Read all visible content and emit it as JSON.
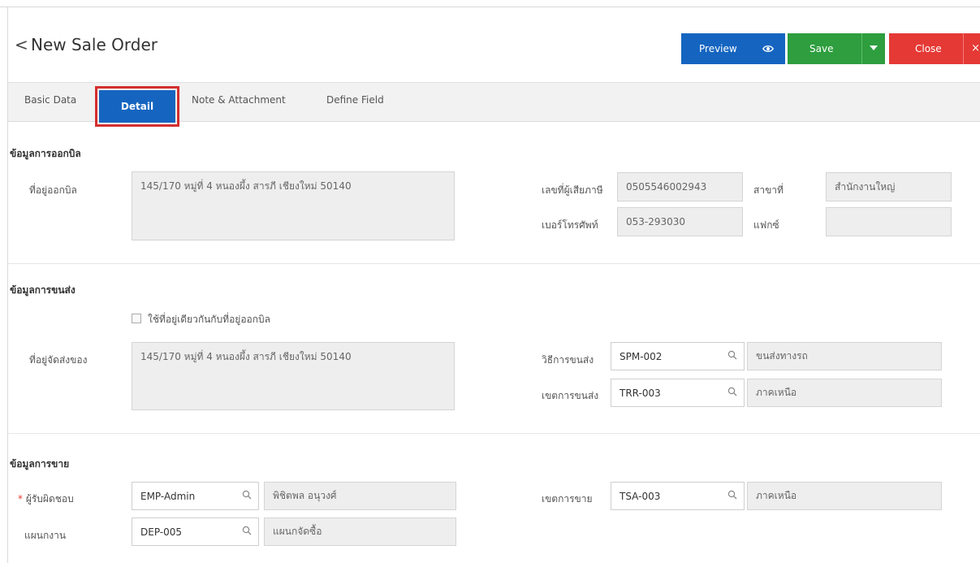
{
  "header": {
    "back_icon": "chevron-left-icon",
    "back_glyph": "<",
    "title": "New Sale Order",
    "preview_label": "Preview",
    "save_label": "Save",
    "close_label": "Close",
    "close_glyph": "×",
    "colors": {
      "preview": "#1565c0",
      "save": "#2e9e3e",
      "close": "#e53935"
    }
  },
  "tabs": [
    {
      "label": "Basic Data"
    },
    {
      "label": "Detail",
      "active": true
    },
    {
      "label": "Note & Attachment"
    },
    {
      "label": "Define Field"
    }
  ],
  "billing": {
    "title": "ข้อมูลการออกบิล",
    "address_label": "ที่อยู่ออกบิล",
    "address_value": "145/170 หมู่ที่ 4    หนองผึ้ง สารภี เชียงใหม่ 50140",
    "tax_id_label": "เลขที่ผู้เสียภาษี",
    "tax_id_value": "0505546002943",
    "branch_label": "สาขาที่",
    "branch_value": "สำนักงานใหญ่",
    "phone_label": "เบอร์โทรศัพท์",
    "phone_value": "053-293030",
    "fax_label": "แฟกซ์",
    "fax_value": ""
  },
  "shipping": {
    "title": "ข้อมูลการขนส่ง",
    "same_address_label": "ใช้ที่อยู่เดียวกันกับที่อยู่ออกบิล",
    "same_address_checked": false,
    "address_label": "ที่อยู่จัดส่งของ",
    "address_value": "145/170 หมู่ที่ 4    หนองผึ้ง สารภี เชียงใหม่ 50140",
    "method_label": "วิธีการขนส่ง",
    "method_code": "SPM-002",
    "method_name": "ขนส่งทางรถ",
    "zone_label": "เขตการขนส่ง",
    "zone_code": "TRR-003",
    "zone_name": "ภาคเหนือ"
  },
  "sales": {
    "title": "ข้อมูลการขาย",
    "required_mark": "*",
    "owner_label": "ผู้รับผิดชอบ",
    "owner_code": "EMP-Admin",
    "owner_name": "พิชิตพล อนุวงศ์",
    "dept_label": "แผนกงาน",
    "dept_code": "DEP-005",
    "dept_name": "แผนกจัดซื้อ",
    "area_label": "เขตการขาย",
    "area_code": "TSA-003",
    "area_name": "ภาคเหนือ"
  }
}
